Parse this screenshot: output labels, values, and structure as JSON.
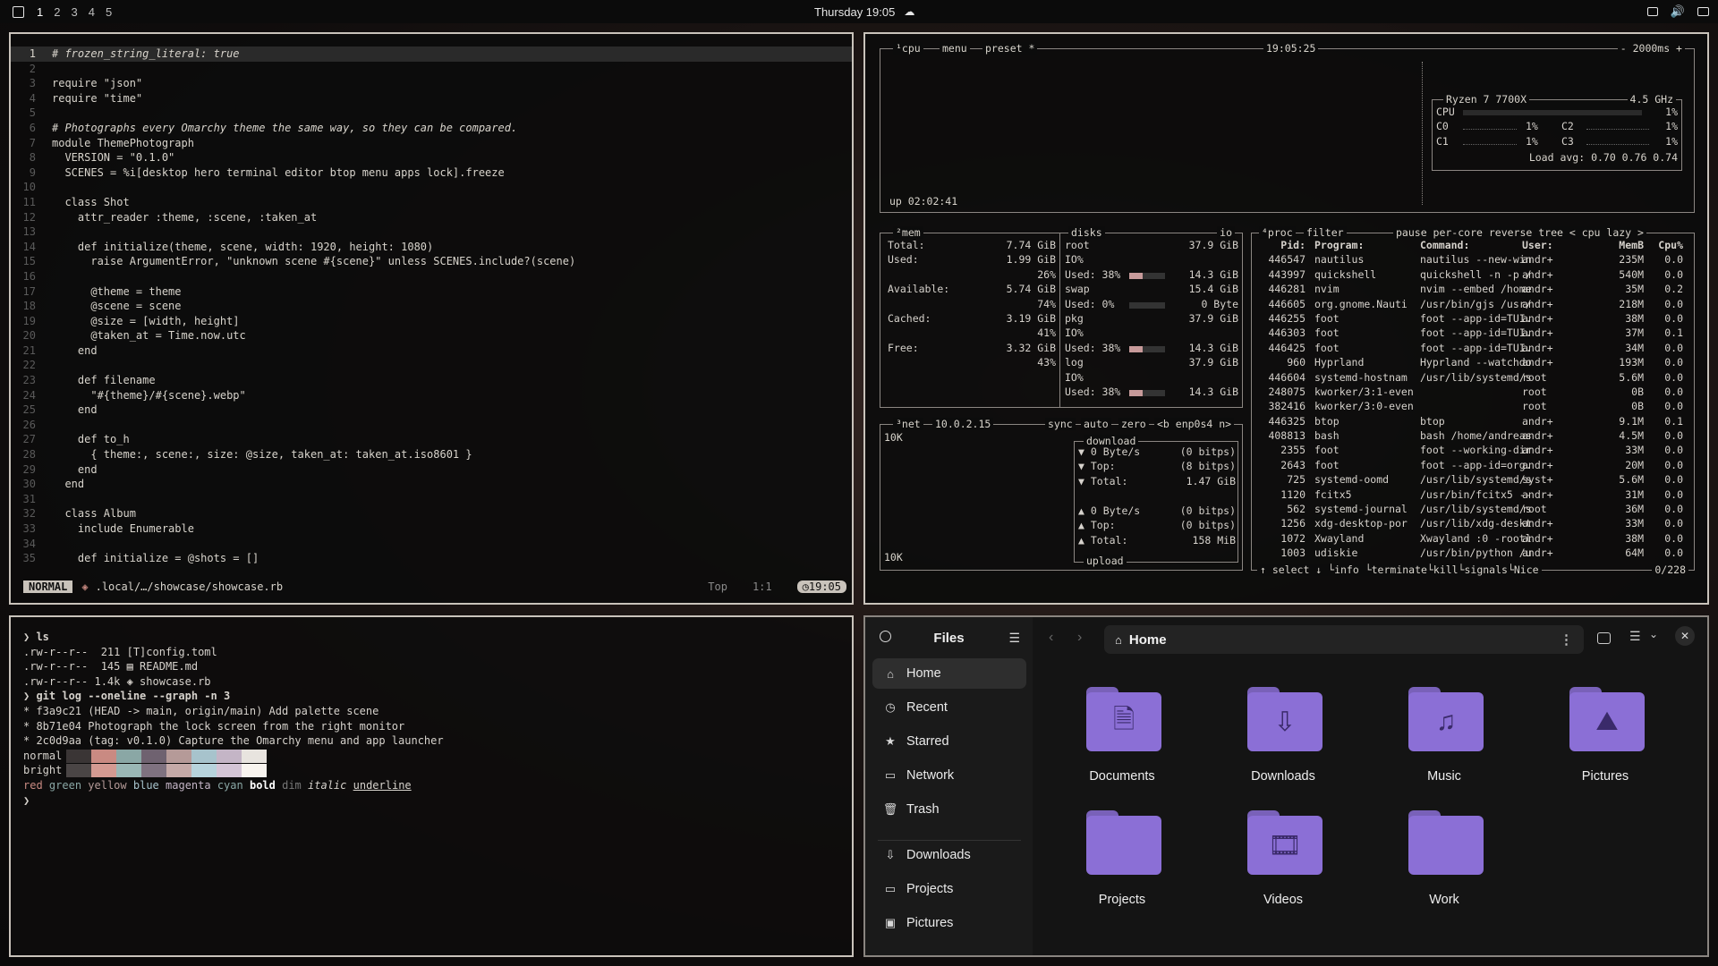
{
  "topbar": {
    "workspaces": [
      "1",
      "2",
      "3",
      "4",
      "5"
    ],
    "clock": "Thursday 19:05"
  },
  "editor": {
    "lines": [
      {
        "n": "1",
        "t": "# frozen_string_literal: true",
        "cls": "c-com",
        "cur": true
      },
      {
        "n": "2",
        "t": ""
      },
      {
        "n": "3",
        "t": "require \"json\""
      },
      {
        "n": "4",
        "t": "require \"time\""
      },
      {
        "n": "5",
        "t": ""
      },
      {
        "n": "6",
        "t": "# Photographs every Omarchy theme the same way, so they can be compared.",
        "cls": "c-com"
      },
      {
        "n": "7",
        "t": "module ThemePhotograph"
      },
      {
        "n": "8",
        "t": "  VERSION = \"0.1.0\""
      },
      {
        "n": "9",
        "t": "  SCENES = %i[desktop hero terminal editor btop menu apps lock].freeze"
      },
      {
        "n": "10",
        "t": ""
      },
      {
        "n": "11",
        "t": "  class Shot"
      },
      {
        "n": "12",
        "t": "    attr_reader :theme, :scene, :taken_at"
      },
      {
        "n": "13",
        "t": ""
      },
      {
        "n": "14",
        "t": "    def initialize(theme, scene, width: 1920, height: 1080)"
      },
      {
        "n": "15",
        "t": "      raise ArgumentError, \"unknown scene #{scene}\" unless SCENES.include?(scene)"
      },
      {
        "n": "16",
        "t": ""
      },
      {
        "n": "17",
        "t": "      @theme = theme"
      },
      {
        "n": "18",
        "t": "      @scene = scene"
      },
      {
        "n": "19",
        "t": "      @size = [width, height]"
      },
      {
        "n": "20",
        "t": "      @taken_at = Time.now.utc"
      },
      {
        "n": "21",
        "t": "    end"
      },
      {
        "n": "22",
        "t": ""
      },
      {
        "n": "23",
        "t": "    def filename"
      },
      {
        "n": "24",
        "t": "      \"#{theme}/#{scene}.webp\""
      },
      {
        "n": "25",
        "t": "    end"
      },
      {
        "n": "26",
        "t": ""
      },
      {
        "n": "27",
        "t": "    def to_h"
      },
      {
        "n": "28",
        "t": "      { theme:, scene:, size: @size, taken_at: taken_at.iso8601 }"
      },
      {
        "n": "29",
        "t": "    end"
      },
      {
        "n": "30",
        "t": "  end"
      },
      {
        "n": "31",
        "t": ""
      },
      {
        "n": "32",
        "t": "  class Album"
      },
      {
        "n": "33",
        "t": "    include Enumerable"
      },
      {
        "n": "34",
        "t": ""
      },
      {
        "n": "35",
        "t": "    def initialize = @shots = []"
      }
    ],
    "status": {
      "mode": "NORMAL",
      "file": ".local/…/showcase/showcase.rb",
      "position": "Top",
      "cursor": "1:1",
      "time": "19:05"
    }
  },
  "btop": {
    "cpu_header": {
      "label": "¹cpu",
      "menu": "menu",
      "preset": "preset *",
      "time": "19:05:25",
      "interval": "- 2000ms +"
    },
    "uptime": "up 02:02:41",
    "cpu_box": {
      "model": "Ryzen 7 7700X",
      "freq": "4.5 GHz",
      "rows": [
        {
          "name": "CPU",
          "pct": "1%"
        },
        {
          "name": "C0",
          "pct": "1%",
          "name2": "C2",
          "pct2": "1%"
        },
        {
          "name": "C1",
          "pct": "1%",
          "name2": "C3",
          "pct2": "1%"
        }
      ],
      "load": "Load avg: 0.70 0.76 0.74"
    },
    "mem": {
      "label": "²mem",
      "rows": [
        {
          "k": "Total:",
          "v": "7.74 GiB"
        },
        {
          "k": "Used:",
          "v": "1.99 GiB",
          "p": "26%"
        },
        {
          "k": "Available:",
          "v": "5.74 GiB",
          "p": "74%"
        },
        {
          "k": "Cached:",
          "v": "3.19 GiB",
          "p": "41%"
        },
        {
          "k": "Free:",
          "v": "3.32 GiB",
          "p": "43%"
        }
      ]
    },
    "disks": {
      "label": "disks",
      "io": "io",
      "items": [
        {
          "name": "root",
          "size": "37.9 GiB",
          "io": "IO%",
          "used": "Used: 38%",
          "usedv": "14.3 GiB",
          "frac": 0.38
        },
        {
          "name": "swap",
          "size": "15.4 GiB",
          "io": "",
          "used": "Used:  0%",
          "usedv": "0 Byte",
          "frac": 0.0
        },
        {
          "name": "pkg",
          "size": "37.9 GiB",
          "io": "IO%",
          "used": "Used: 38%",
          "usedv": "14.3 GiB",
          "frac": 0.38
        },
        {
          "name": "log",
          "size": "37.9 GiB",
          "io": "IO%",
          "used": "Used: 38%",
          "usedv": "14.3 GiB",
          "frac": 0.38
        }
      ]
    },
    "net": {
      "label": "³net",
      "ip": "10.0.2.15",
      "controls": "sync",
      "auto": "auto",
      "zero": "zero",
      "iface": "<b enp0s4 n>",
      "scale_top": "10K",
      "scale_bottom": "10K",
      "download_label": "download",
      "upload_label": "upload",
      "download": [
        {
          "k": "▼ 0 Byte/s",
          "v": "(0 bitps)"
        },
        {
          "k": "▼ Top:",
          "v": "(8 bitps)"
        },
        {
          "k": "▼ Total:",
          "v": "1.47 GiB"
        }
      ],
      "upload": [
        {
          "k": "▲ 0 Byte/s",
          "v": "(0 bitps)"
        },
        {
          "k": "▲ Top:",
          "v": "(0 bitps)"
        },
        {
          "k": "▲ Total:",
          "v": "158 MiB"
        }
      ]
    },
    "proc": {
      "label": "⁴proc",
      "filter": "filter",
      "opts": "pause per-core reverse tree < cpu lazy >",
      "headers": {
        "pid": "Pid:",
        "prog": "Program:",
        "cmd": "Command:",
        "user": "User:",
        "mem": "MemB",
        "cpu": "Cpu%"
      },
      "rows": [
        {
          "pid": "446547",
          "prog": "nautilus",
          "cmd": "nautilus --new-win",
          "user": "andr+",
          "mem": "235M",
          "cpu": "0.0"
        },
        {
          "pid": "443997",
          "prog": "quickshell",
          "cmd": "quickshell -n -p /",
          "user": "andr+",
          "mem": "540M",
          "cpu": "0.0"
        },
        {
          "pid": "446281",
          "prog": "nvim",
          "cmd": "nvim --embed /home",
          "user": "andr+",
          "mem": "35M",
          "cpu": "0.2"
        },
        {
          "pid": "446605",
          "prog": "org.gnome.Nauti",
          "cmd": "/usr/bin/gjs /usr/",
          "user": "andr+",
          "mem": "218M",
          "cpu": "0.0"
        },
        {
          "pid": "446255",
          "prog": "foot",
          "cmd": "foot --app-id=TUI.",
          "user": "andr+",
          "mem": "38M",
          "cpu": "0.0"
        },
        {
          "pid": "446303",
          "prog": "foot",
          "cmd": "foot --app-id=TUI.",
          "user": "andr+",
          "mem": "37M",
          "cpu": "0.1"
        },
        {
          "pid": "446425",
          "prog": "foot",
          "cmd": "foot --app-id=TUI.",
          "user": "andr+",
          "mem": "34M",
          "cpu": "0.0"
        },
        {
          "pid": "960",
          "prog": "Hyprland",
          "cmd": "Hyprland --watchdo",
          "user": "andr+",
          "mem": "193M",
          "cpu": "0.0"
        },
        {
          "pid": "446604",
          "prog": "systemd-hostnam",
          "cmd": "/usr/lib/systemd/s",
          "user": "root",
          "mem": "5.6M",
          "cpu": "0.0"
        },
        {
          "pid": "248075",
          "prog": "kworker/3:1-even",
          "cmd": "",
          "user": "root",
          "mem": "0B",
          "cpu": "0.0"
        },
        {
          "pid": "382416",
          "prog": "kworker/3:0-even",
          "cmd": "",
          "user": "root",
          "mem": "0B",
          "cpu": "0.0"
        },
        {
          "pid": "446325",
          "prog": "btop",
          "cmd": "btop",
          "user": "andr+",
          "mem": "9.1M",
          "cpu": "0.1"
        },
        {
          "pid": "408813",
          "prog": "bash",
          "cmd": "bash /home/andreas",
          "user": "andr+",
          "mem": "4.5M",
          "cpu": "0.0"
        },
        {
          "pid": "2355",
          "prog": "foot",
          "cmd": "foot --working-dir",
          "user": "andr+",
          "mem": "33M",
          "cpu": "0.0"
        },
        {
          "pid": "2643",
          "prog": "foot",
          "cmd": "foot --app-id=org.",
          "user": "andr+",
          "mem": "20M",
          "cpu": "0.0"
        },
        {
          "pid": "725",
          "prog": "systemd-oomd",
          "cmd": "/usr/lib/systemd/s",
          "user": "syst+",
          "mem": "5.6M",
          "cpu": "0.0"
        },
        {
          "pid": "1120",
          "prog": "fcitx5",
          "cmd": "/usr/bin/fcitx5 --",
          "user": "andr+",
          "mem": "31M",
          "cpu": "0.0"
        },
        {
          "pid": "562",
          "prog": "systemd-journal",
          "cmd": "/usr/lib/systemd/s",
          "user": "root",
          "mem": "36M",
          "cpu": "0.0"
        },
        {
          "pid": "1256",
          "prog": "xdg-desktop-por",
          "cmd": "/usr/lib/xdg-deskt",
          "user": "andr+",
          "mem": "33M",
          "cpu": "0.0"
        },
        {
          "pid": "1072",
          "prog": "Xwayland",
          "cmd": "Xwayland :0 -rootl",
          "user": "andr+",
          "mem": "38M",
          "cpu": "0.0"
        },
        {
          "pid": "1003",
          "prog": "udiskie",
          "cmd": "/usr/bin/python /u",
          "user": "andr+",
          "mem": "64M",
          "cpu": "0.0"
        }
      ],
      "footer": "↑ select ↓ └info └terminate└kill└signals└Nice",
      "count": "0/228"
    }
  },
  "terminal": {
    "lines": [
      {
        "t": "❯ ls",
        "b": true
      },
      {
        "t": ".rw-r--r--  211 [T]config.toml"
      },
      {
        "t": ".rw-r--r--  145 ▤ README.md"
      },
      {
        "t": ".rw-r--r-- 1.4k ◈ showcase.rb"
      },
      {
        "t": "❯ git log --oneline --graph -n 3",
        "b": true
      },
      {
        "t": "* f3a9c21 (HEAD -> main, origin/main) Add palette scene"
      },
      {
        "t": "* 8b71e04 Photograph the lock screen from the right monitor"
      },
      {
        "t": "* 2c0d9aa (tag: v0.1.0) Capture the Omarchy menu and app launcher"
      }
    ],
    "palette": {
      "normal_label": "normal",
      "bright_label": "bright",
      "normal": [
        "#3a3535",
        "#c98a82",
        "#8aa7a5",
        "#6f6270",
        "#b59a98",
        "#a7c3cc",
        "#c4b5c6",
        "#e8e4df"
      ],
      "bright": [
        "#4a4545",
        "#d49a92",
        "#9ab7b5",
        "#7f7280",
        "#c5aaa8",
        "#b7d3dc",
        "#d4c5d6",
        "#f8f4ef"
      ]
    },
    "styles_line": "red green yellow blue magenta cyan bold dim italic underline",
    "prompt": "❯"
  },
  "files": {
    "title": "Files",
    "path": "Home",
    "sidebar": [
      {
        "label": "Home",
        "icon": "home-icon",
        "active": true
      },
      {
        "label": "Recent",
        "icon": "clock-icon"
      },
      {
        "label": "Starred",
        "icon": "star-icon"
      },
      {
        "label": "Network",
        "icon": "network-icon"
      },
      {
        "label": "Trash",
        "icon": "trash-icon"
      },
      {
        "label": "Downloads",
        "icon": "download-icon"
      },
      {
        "label": "Projects",
        "icon": "folder-icon"
      },
      {
        "label": "Pictures",
        "icon": "image-icon"
      }
    ],
    "folders": [
      {
        "label": "Documents",
        "glyph": "doc"
      },
      {
        "label": "Downloads",
        "glyph": "down"
      },
      {
        "label": "Music",
        "glyph": "music"
      },
      {
        "label": "Pictures",
        "glyph": "pic"
      },
      {
        "label": "Projects",
        "glyph": ""
      },
      {
        "label": "Videos",
        "glyph": "video"
      },
      {
        "label": "Work",
        "glyph": ""
      }
    ],
    "accent": "#8b6fd6"
  }
}
